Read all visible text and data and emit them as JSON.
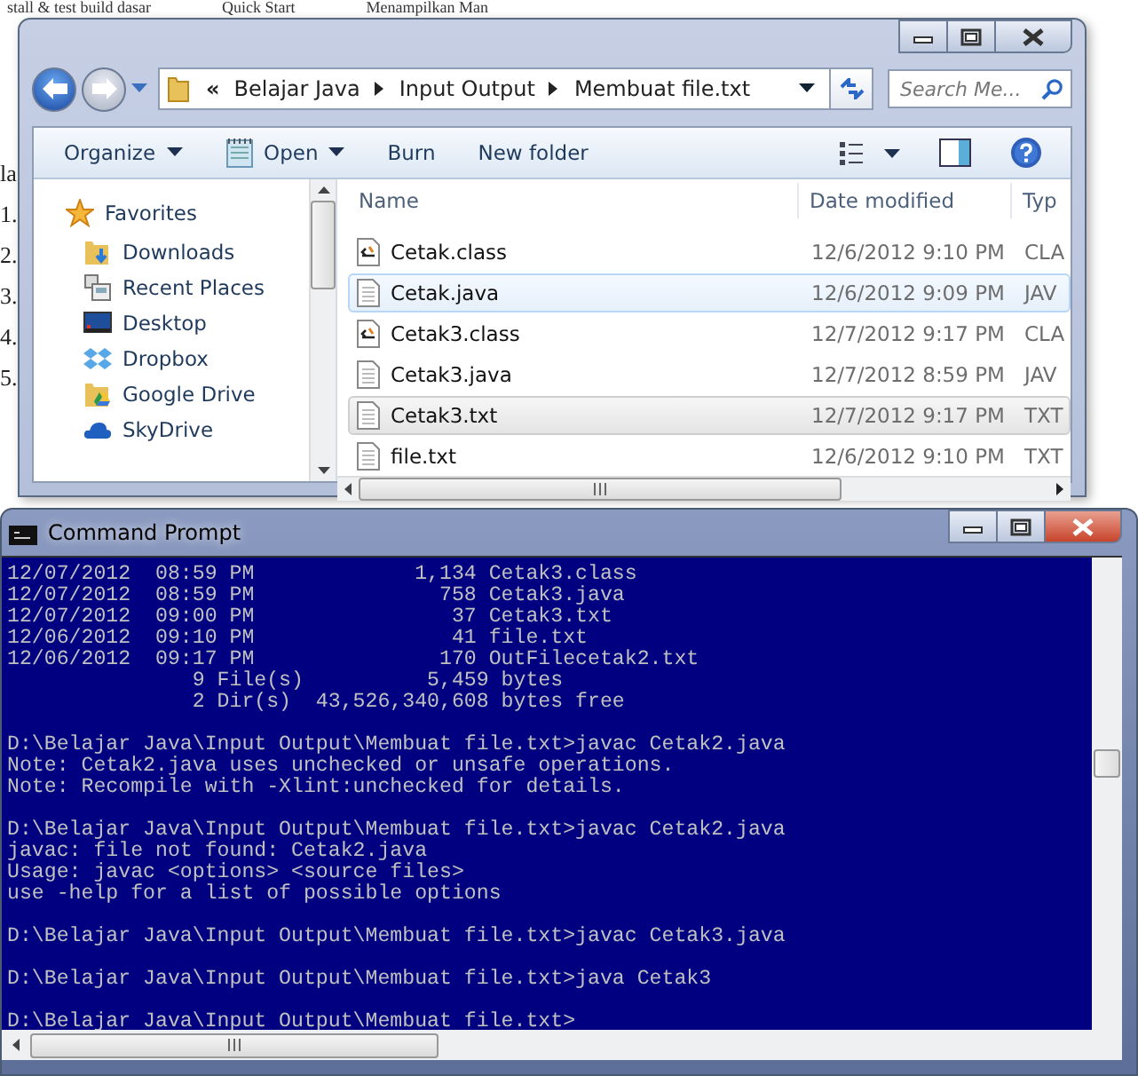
{
  "background_document": {
    "top_texts": [
      "stall & test build dasar",
      "Quick Start",
      "Menampilkan Man"
    ],
    "left_texts": [
      "la",
      "1.",
      "2.",
      "3.",
      "4.",
      "5."
    ]
  },
  "explorer": {
    "breadcrumb": {
      "overflow": "«",
      "segments": [
        "Belajar Java",
        "Input Output",
        "Membuat file.txt"
      ]
    },
    "search": {
      "placeholder": "Search Me..."
    },
    "toolbar": [
      {
        "label": "Organize",
        "dropdown": true
      },
      {
        "label": "Open",
        "dropdown": true
      },
      {
        "label": "Burn",
        "dropdown": false
      },
      {
        "label": "New folder",
        "dropdown": false
      }
    ],
    "sidebar": {
      "items": [
        {
          "label": "Favorites",
          "header": true
        },
        {
          "label": "Downloads",
          "header": false
        },
        {
          "label": "Recent Places",
          "header": false
        },
        {
          "label": "Desktop",
          "header": false
        },
        {
          "label": "Dropbox",
          "header": false
        },
        {
          "label": "Google Drive",
          "header": false
        },
        {
          "label": "SkyDrive",
          "header": false
        }
      ]
    },
    "columns": [
      "Name",
      "Date modified",
      "Typ"
    ],
    "files": [
      {
        "name": "Cetak.class",
        "date": "12/6/2012 9:10 PM",
        "type": "CLA",
        "kind": "class",
        "hovered": false,
        "selected": false
      },
      {
        "name": "Cetak.java",
        "date": "12/6/2012 9:09 PM",
        "type": "JAV",
        "kind": "text",
        "hovered": true,
        "selected": false
      },
      {
        "name": "Cetak3.class",
        "date": "12/7/2012 9:17 PM",
        "type": "CLA",
        "kind": "class",
        "hovered": false,
        "selected": false
      },
      {
        "name": "Cetak3.java",
        "date": "12/7/2012 8:59 PM",
        "type": "JAV",
        "kind": "text",
        "hovered": false,
        "selected": false
      },
      {
        "name": "Cetak3.txt",
        "date": "12/7/2012 9:17 PM",
        "type": "TXT",
        "kind": "text",
        "hovered": false,
        "selected": true
      },
      {
        "name": "file.txt",
        "date": "12/6/2012 9:10 PM",
        "type": "TXT",
        "kind": "text",
        "hovered": false,
        "selected": false
      }
    ]
  },
  "command_prompt": {
    "title": "Command Prompt",
    "blocks": [
      [
        "12/07/2012  08:59 PM             1,134 Cetak3.class",
        "12/07/2012  08:59 PM               758 Cetak3.java",
        "12/07/2012  09:00 PM                37 Cetak3.txt",
        "12/06/2012  09:10 PM                41 file.txt",
        "12/06/2012  09:17 PM               170 OutFilecetak2.txt",
        "               9 File(s)          5,459 bytes",
        "               2 Dir(s)  43,526,340,608 bytes free"
      ],
      [
        "D:\\Belajar Java\\Input Output\\Membuat file.txt>javac Cetak2.java",
        "Note: Cetak2.java uses unchecked or unsafe operations.",
        "Note: Recompile with -Xlint:unchecked for details."
      ],
      [
        "D:\\Belajar Java\\Input Output\\Membuat file.txt>javac Cetak2.java",
        "javac: file not found: Cetak2.java",
        "Usage: javac <options> <source files>",
        "use -help for a list of possible options"
      ],
      [
        "D:\\Belajar Java\\Input Output\\Membuat file.txt>javac Cetak3.java"
      ],
      [
        "D:\\Belajar Java\\Input Output\\Membuat file.txt>java Cetak3"
      ],
      [
        "D:\\Belajar Java\\Input Output\\Membuat file.txt>"
      ]
    ]
  }
}
